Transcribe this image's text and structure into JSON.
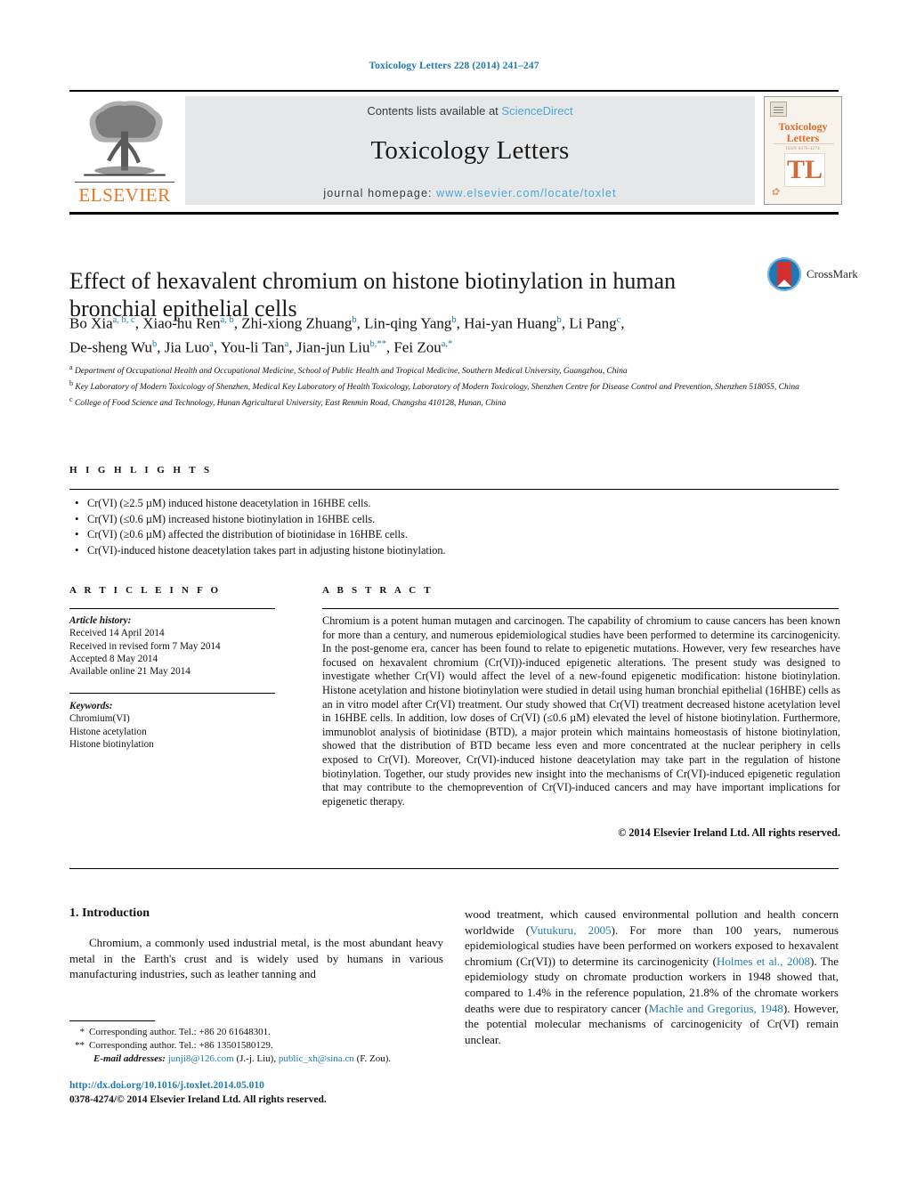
{
  "running_head": "Toxicology Letters 228 (2014) 241–247",
  "header": {
    "publisher_logo_word": "ELSEVIER",
    "contents_prefix": "Contents lists available at ",
    "contents_link": "ScienceDirect",
    "journal_title": "Toxicology Letters",
    "homepage_prefix": "journal homepage: ",
    "homepage_link": "www.elsevier.com/locate/toxlet",
    "cover": {
      "journal_name_line1": "Toxicology",
      "journal_name_line2": "Letters",
      "subtitle": "ISSN 0378-4274",
      "monogram": "TL"
    }
  },
  "article": {
    "title": "Effect of hexavalent chromium on histone biotinylation in human bronchial epithelial cells",
    "crossmark_label": "CrossMark",
    "authors_line1_html": "Bo Xia<sup>a, b, c</sup>, Xiao-hu Ren<sup>a, b</sup>, Zhi-xiong Zhuang<sup>b</sup>, Lin-qing Yang<sup>b</sup>, Hai-yan Huang<sup>b</sup>, Li Pang<sup>c</sup>,",
    "authors_line2_html": "De-sheng Wu<sup>b</sup>, Jia Luo<sup>a</sup>, You-li Tan<sup>a</sup>, Jian-jun Liu<sup>b,**</sup>, Fei Zou<sup>a,*</sup>",
    "affiliations": [
      {
        "mark": "a",
        "text": "Department of Occupational Health and Occupational Medicine, School of Public Health and Tropical Medicine, Southern Medical University, Guangzhou, China"
      },
      {
        "mark": "b",
        "text": "Key Laboratory of Modern Toxicology of Shenzhen, Medical Key Laboratory of Health Toxicology, Laboratory of Modern Toxicology, Shenzhen Centre for Disease Control and Prevention, Shenzhen 518055, China"
      },
      {
        "mark": "c",
        "text": "College of Food Science and Technology, Hunan Agricultural University, East Renmin Road, Changsha 410128, Hunan, China"
      }
    ]
  },
  "highlights": {
    "label": "H I G H L I G H T S",
    "items": [
      "Cr(VI) (≥2.5 µM) induced histone deacetylation in 16HBE cells.",
      "Cr(VI) (≤0.6 µM) increased histone biotinylation in 16HBE cells.",
      "Cr(VI) (≥0.6 µM) affected the distribution of biotinidase in 16HBE cells.",
      "Cr(VI)-induced histone deacetylation takes part in adjusting histone biotinylation."
    ]
  },
  "article_info": {
    "label": "A R T I C L E    I N F O",
    "history_heading": "Article history:",
    "history": [
      "Received 14 April 2014",
      "Received in revised form 7 May 2014",
      "Accepted 8 May 2014",
      "Available online 21 May 2014"
    ],
    "keywords_heading": "Keywords:",
    "keywords": [
      "Chromium(VI)",
      "Histone acetylation",
      "Histone biotinylation"
    ]
  },
  "abstract": {
    "label": "A B S T R A C T",
    "text": "Chromium is a potent human mutagen and carcinogen. The capability of chromium to cause cancers has been known for more than a century, and numerous epidemiological studies have been performed to determine its carcinogenicity. In the post-genome era, cancer has been found to relate to epigenetic mutations. However, very few researches have focused on hexavalent chromium (Cr(VI))-induced epigenetic alterations. The present study was designed to investigate whether Cr(VI) would affect the level of a new-found epigenetic modification: histone biotinylation. Histone acetylation and histone biotinylation were studied in detail using human bronchial epithelial (16HBE) cells as an in vitro model after Cr(VI) treatment. Our study showed that Cr(VI) treatment decreased histone acetylation level in 16HBE cells. In addition, low doses of Cr(VI) (≤0.6 µM) elevated the level of histone biotinylation. Furthermore, immunoblot analysis of biotinidase (BTD), a major protein which maintains homeostasis of histone biotinylation, showed that the distribution of BTD became less even and more concentrated at the nuclear periphery in cells exposed to Cr(VI). Moreover, Cr(VI)-induced histone deacetylation may take part in the regulation of histone biotinylation. Together, our study provides new insight into the mechanisms of Cr(VI)-induced epigenetic regulation that may contribute to the chemoprevention of Cr(VI)-induced cancers and may have important implications for epigenetic therapy.",
    "copyright": "© 2014 Elsevier Ireland Ltd. All rights reserved."
  },
  "body": {
    "section_number_title": "1.  Introduction",
    "left_paragraph": "Chromium, a commonly used industrial metal, is the most abundant heavy metal in the Earth's crust and is widely used by humans in various manufacturing industries, such as leather tanning and",
    "right_column": {
      "seg1": "wood treatment, which caused environmental pollution and health concern worldwide (",
      "ref1": "Vutukuru, 2005",
      "seg2": "). For more than 100 years, numerous epidemiological studies have been performed on workers exposed to hexavalent chromium (Cr(VI)) to determine its carcinogenicity (",
      "ref2": "Holmes et al., 2008",
      "seg3": "). The epidemiology study on chromate production workers in 1948 showed that, compared to 1.4% in the reference population, 21.8% of the chromate workers deaths were due to respiratory cancer (",
      "ref3": "Machle and Gregorius, 1948",
      "seg4": "). However, the potential molecular mechanisms of carcinogenicity of Cr(VI) remain unclear."
    }
  },
  "footnotes": {
    "corresponding1_mark": "*",
    "corresponding1": "Corresponding author. Tel.: +86 20 61648301.",
    "corresponding2_mark": "**",
    "corresponding2": "Corresponding author. Tel.: +86 13501580129.",
    "email_label": "E-mail addresses:",
    "email1": "junji8@126.com",
    "email1_owner": "(J.-j. Liu),",
    "email2": "public_xh@sina.cn",
    "email2_owner": "(F. Zou).",
    "doi": "http://dx.doi.org/10.1016/j.toxlet.2014.05.010",
    "issn_line": "0378-4274/© 2014 Elsevier Ireland Ltd. All rights reserved."
  },
  "colors": {
    "link_blue": "#1f7bad",
    "banner_link_blue": "#4aa8d8",
    "elsevier_orange": "#e87722",
    "banner_grey": "#e6e7e8"
  }
}
